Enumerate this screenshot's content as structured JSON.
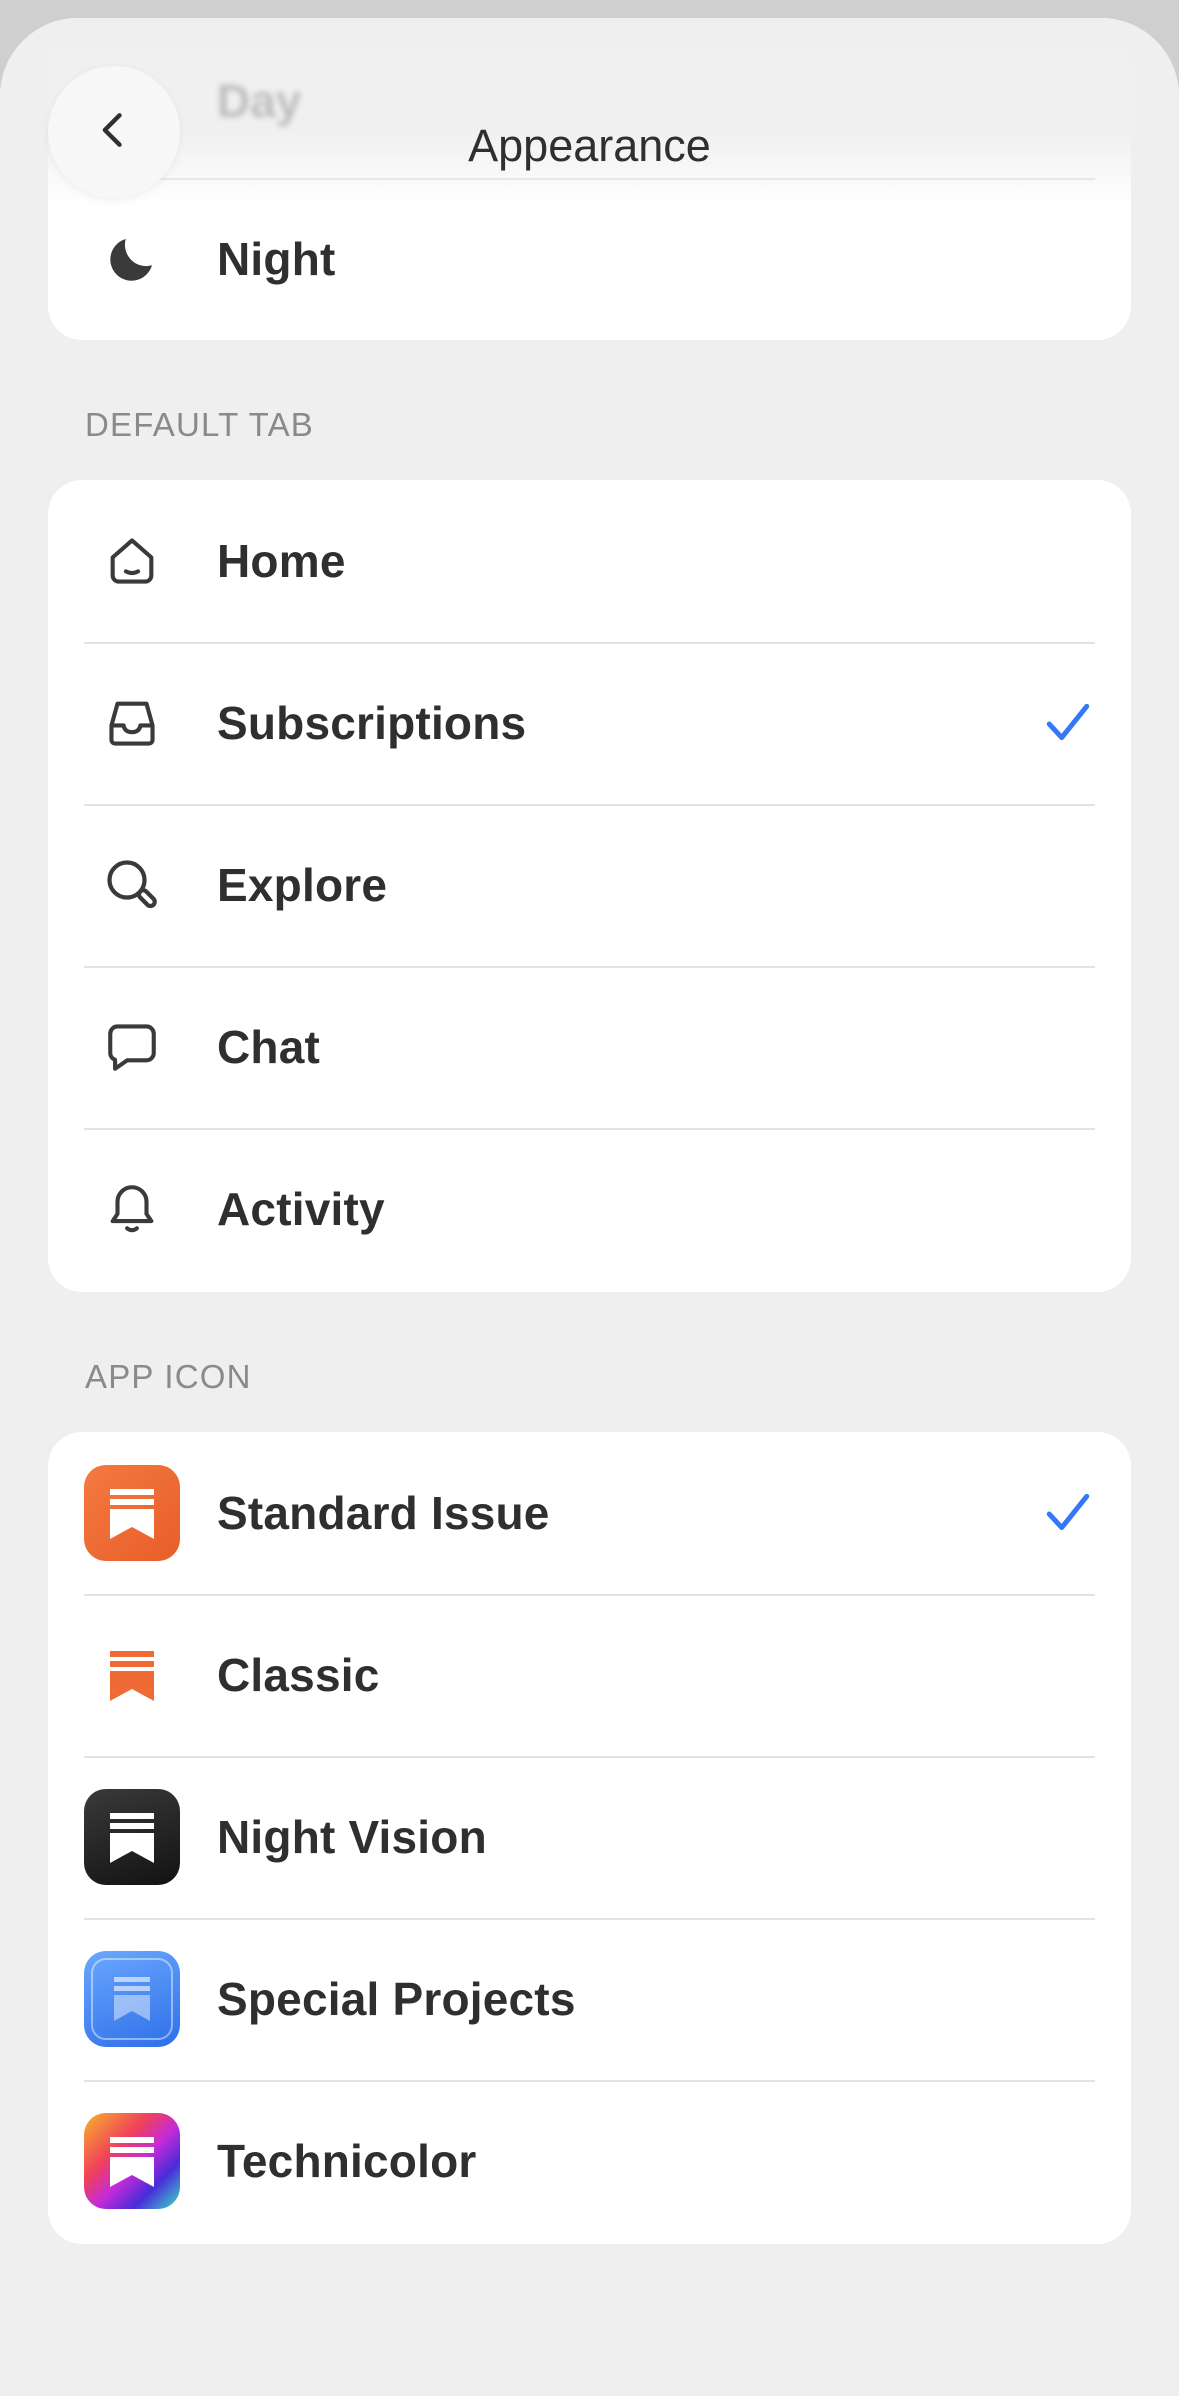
{
  "header": {
    "title": "Appearance",
    "back_icon": "chevron-left-icon"
  },
  "appearance_mode": {
    "items": [
      {
        "label": "Day",
        "icon": "sun-icon"
      },
      {
        "label": "Night",
        "icon": "moon-icon"
      }
    ]
  },
  "default_tab": {
    "section_label": "DEFAULT TAB",
    "items": [
      {
        "label": "Home",
        "icon": "home-icon",
        "selected": false
      },
      {
        "label": "Subscriptions",
        "icon": "inbox-icon",
        "selected": true
      },
      {
        "label": "Explore",
        "icon": "search-icon",
        "selected": false
      },
      {
        "label": "Chat",
        "icon": "chat-bubble-icon",
        "selected": false
      },
      {
        "label": "Activity",
        "icon": "bell-icon",
        "selected": false
      }
    ]
  },
  "app_icon": {
    "section_label": "APP ICON",
    "items": [
      {
        "label": "Standard Issue",
        "icon": "standard-issue-app-icon",
        "selected": true
      },
      {
        "label": "Classic",
        "icon": "classic-app-icon",
        "selected": false
      },
      {
        "label": "Night Vision",
        "icon": "night-vision-app-icon",
        "selected": false
      },
      {
        "label": "Special Projects",
        "icon": "special-projects-app-icon",
        "selected": false
      },
      {
        "label": "Technicolor",
        "icon": "technicolor-app-icon",
        "selected": false
      }
    ]
  },
  "colors": {
    "accent_check": "#3478f6",
    "brand_orange": "#ef6a35"
  }
}
